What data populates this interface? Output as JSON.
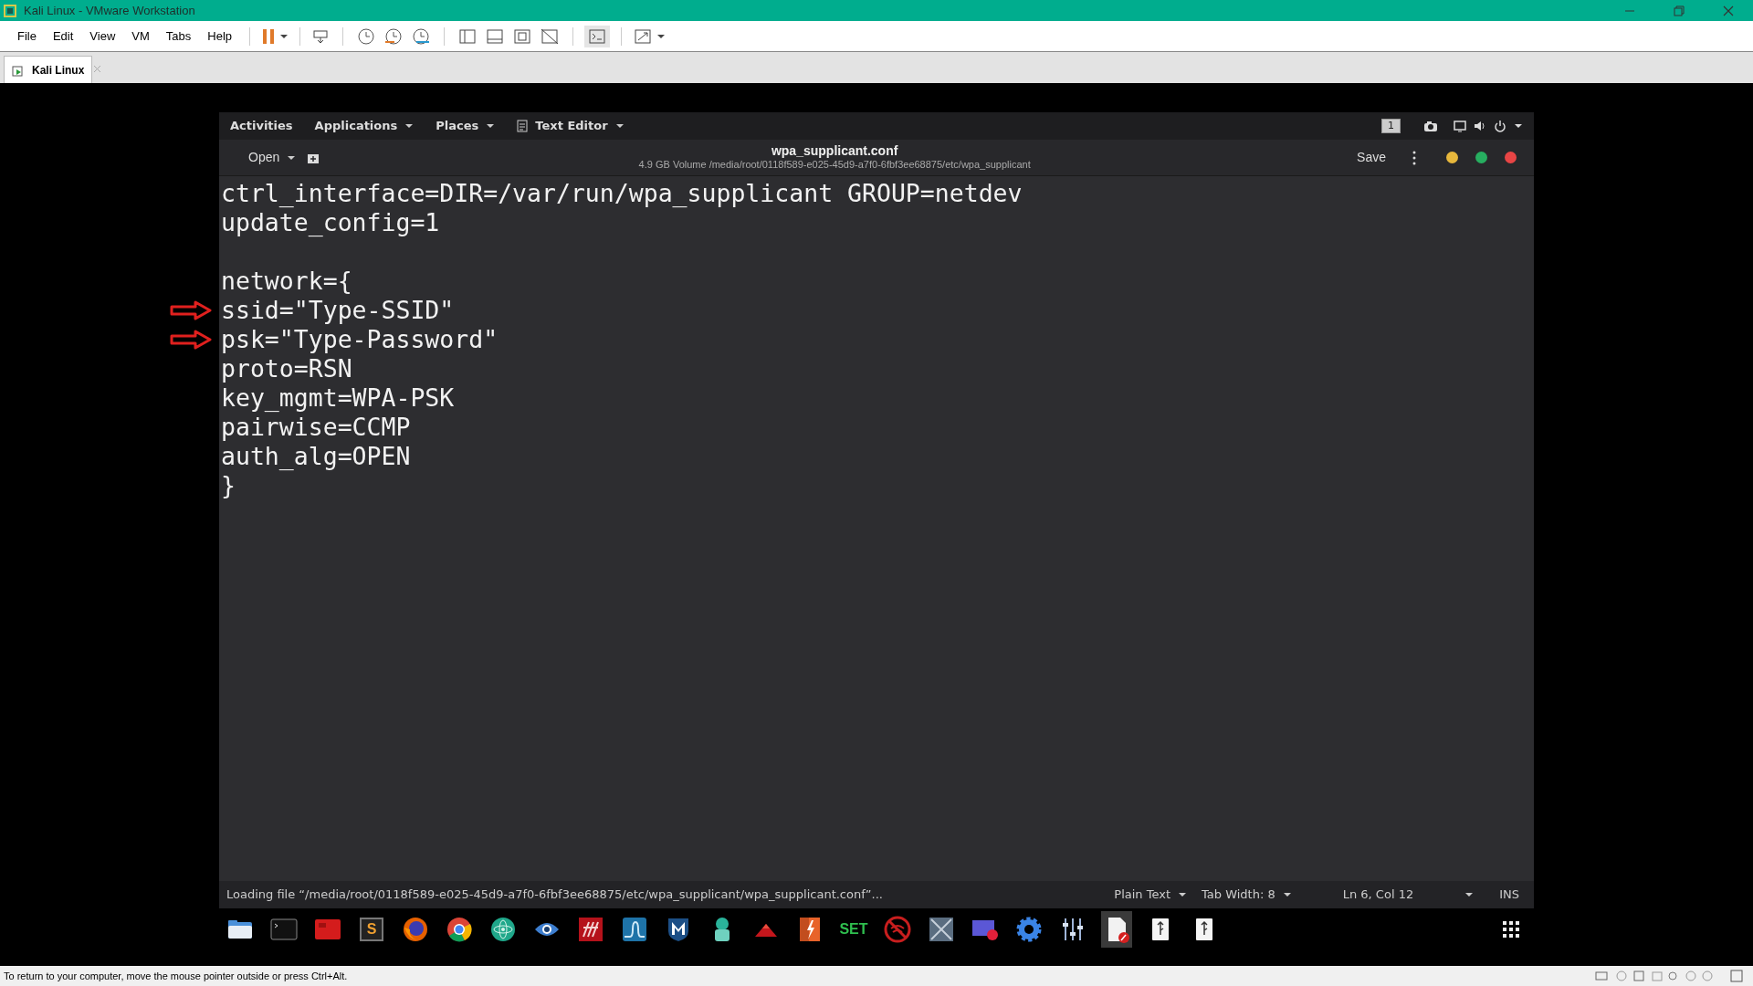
{
  "window": {
    "title": "Kali Linux - VMware Workstation"
  },
  "menu": [
    "File",
    "Edit",
    "View",
    "VM",
    "Tabs",
    "Help"
  ],
  "vm_tabs": [
    {
      "label": "Kali Linux",
      "selected": true
    }
  ],
  "gnome_bar": {
    "activities": "Activities",
    "applications": "Applications",
    "places": "Places",
    "app": "Text Editor",
    "workspace": "1"
  },
  "header": {
    "open": "Open",
    "title": "wpa_supplicant.conf",
    "subtitle": "4.9 GB Volume /media/root/0118f589-e025-45d9-a7f0-6fbf3ee68875/etc/wpa_supplicant",
    "save": "Save"
  },
  "editor_lines": [
    {
      "kind": "text",
      "text": "ctrl_interface=DIR=/var/run/wpa_supplicant GROUP=netdev",
      "marked": false
    },
    {
      "kind": "text",
      "text": "update_config=1",
      "marked": false
    },
    {
      "kind": "blank",
      "marked": false
    },
    {
      "kind": "text",
      "text": "network={",
      "marked": false
    },
    {
      "kind": "text",
      "text": "ssid=\"Type-SSID\"",
      "marked": true
    },
    {
      "kind": "text",
      "text": "psk=\"Type-Password\"",
      "marked": true
    },
    {
      "kind": "text",
      "text": "proto=RSN",
      "marked": false
    },
    {
      "kind": "text",
      "text": "key_mgmt=WPA-PSK",
      "marked": false
    },
    {
      "kind": "text",
      "text": "pairwise=CCMP",
      "marked": false
    },
    {
      "kind": "text",
      "text": "auth_alg=OPEN",
      "marked": false
    },
    {
      "kind": "text",
      "text": "}",
      "marked": false
    }
  ],
  "status_bar": {
    "message": "Loading file “/media/root/0118f589-e025-45d9-a7f0-6fbf3ee68875/etc/wpa_supplicant/wpa_supplicant.conf”...",
    "language": "Plain Text",
    "tab_width": "Tab Width: 8",
    "position": "Ln 6, Col 12",
    "mode": "INS"
  },
  "dock": [
    {
      "kind": "files",
      "selected": false
    },
    {
      "kind": "terminal",
      "selected": false
    },
    {
      "kind": "red",
      "selected": false
    },
    {
      "kind": "letter",
      "label": "S",
      "selected": false
    },
    {
      "kind": "firefox",
      "selected": false
    },
    {
      "kind": "chrome",
      "selected": false
    },
    {
      "kind": "atom",
      "selected": false
    },
    {
      "kind": "eye",
      "selected": false
    },
    {
      "kind": "grid",
      "selected": false
    },
    {
      "kind": "wave",
      "selected": false
    },
    {
      "kind": "shield",
      "selected": false
    },
    {
      "kind": "figure",
      "selected": false
    },
    {
      "kind": "triangle",
      "selected": false
    },
    {
      "kind": "bolt",
      "selected": false
    },
    {
      "kind": "word",
      "label": "SET",
      "selected": false
    },
    {
      "kind": "nowifi",
      "selected": false
    },
    {
      "kind": "cross",
      "selected": false
    },
    {
      "kind": "recorder",
      "selected": false
    },
    {
      "kind": "gear",
      "selected": false
    },
    {
      "kind": "sliders",
      "selected": false
    },
    {
      "kind": "document",
      "selected": true
    },
    {
      "kind": "usb",
      "selected": false
    },
    {
      "kind": "usb",
      "selected": false
    }
  ],
  "host_status": "To return to your computer, move the mouse pointer outside or press Ctrl+Alt."
}
